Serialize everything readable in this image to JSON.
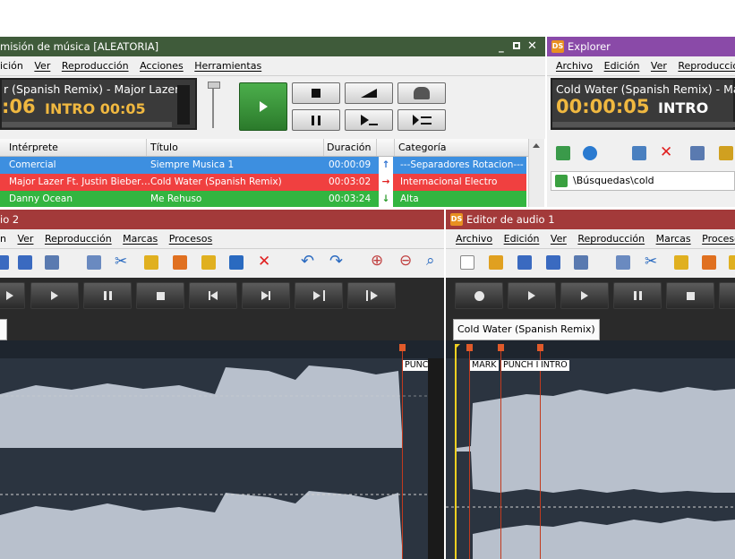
{
  "broadcast": {
    "title": "misión de música [ALEATORIA]",
    "menu": [
      "ición",
      "Ver",
      "Reproducción",
      "Acciones",
      "Herramientas"
    ],
    "now_playing": "r (Spanish Remix) - Major Lazer F",
    "time": ":06",
    "intro": "INTRO 00:05",
    "columns": [
      "Intérprete",
      "Título",
      "Duración",
      "Categoría"
    ],
    "rows": [
      {
        "artist": "Comercial",
        "title": "Siempre Musica 1",
        "duration": "00:00:09",
        "category": "---Separadores Rotacion---",
        "color": "#3d8fe0",
        "arrow": "up"
      },
      {
        "artist": "Major Lazer Ft. Justin Bieber…",
        "title": "Cold Water (Spanish Remix)",
        "duration": "00:03:02",
        "category": "Internacional Electro",
        "color": "#f04040",
        "arrow": "right"
      },
      {
        "artist": "Danny Ocean",
        "title": "Me Rehuso",
        "duration": "00:03:24",
        "category": "Alta",
        "color": "#33b540",
        "arrow": "down"
      }
    ]
  },
  "explorer": {
    "title": "Explorer",
    "menu": [
      "Archivo",
      "Edición",
      "Ver",
      "Reproducción"
    ],
    "now_playing": "Cold Water (Spanish Remix) - Ma",
    "time": "00:00:05",
    "intro": "INTRO",
    "search_path": "\\Búsquedas\\cold"
  },
  "editor2": {
    "title": "io 2",
    "menu": [
      "n",
      "Ver",
      "Reproducción",
      "Marcas",
      "Procesos"
    ],
    "markers": [
      {
        "label": "PUNC"
      }
    ]
  },
  "editor1": {
    "title": "Editor de audio 1",
    "menu": [
      "Archivo",
      "Edición",
      "Ver",
      "Reproducción",
      "Marcas",
      "Procesos"
    ],
    "tab": "Cold Water (Spanish Remix)",
    "markers": [
      {
        "label": "MARK"
      },
      {
        "label": "PUNCH IN"
      },
      {
        "label": "INTRO"
      }
    ]
  },
  "colors": {
    "broadcast_title": "#3f5b3a",
    "explorer_title": "#8a4aa8",
    "editor_title": "#a33a3a",
    "timer_text": "#f0b840",
    "wave": "#b8c0cc"
  }
}
